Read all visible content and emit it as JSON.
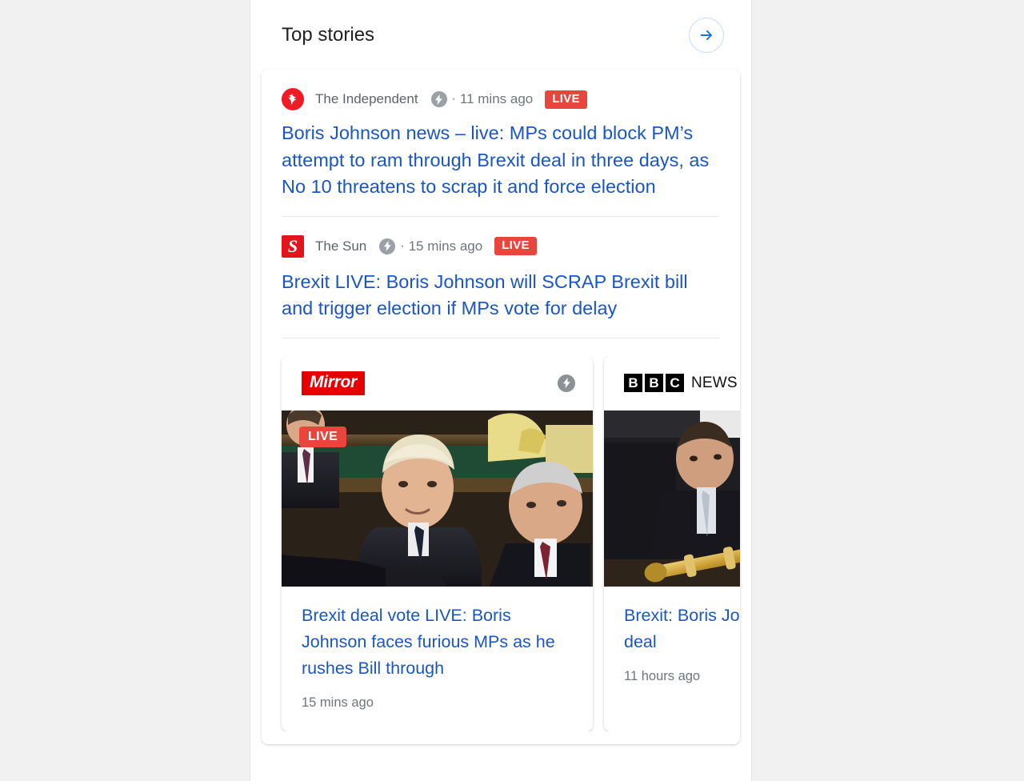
{
  "section": {
    "title": "Top stories",
    "more_button_icon": "arrow-right-icon",
    "accent_link_color": "#1a56c4",
    "live_badge_color": "#e8453c",
    "more_button_border_color": "#c6dafc"
  },
  "text_stories": [
    {
      "source": "The Independent",
      "source_logo": "the-independent-logo",
      "amp_icon": "amp-lightning-icon",
      "separator": "·",
      "timestamp": "11 mins ago",
      "live_label": "LIVE",
      "headline": "Boris Johnson news – live: MPs could block PM’s attempt to ram through Brexit deal in three days, as No 10 threatens to scrap it and force election"
    },
    {
      "source": "The Sun",
      "source_logo": "the-sun-logo",
      "source_logo_letter": "S",
      "amp_icon": "amp-lightning-icon",
      "separator": "·",
      "timestamp": "15 mins ago",
      "live_label": "LIVE",
      "headline": "Brexit LIVE: Boris Johnson will SCRAP Brexit bill and trigger election if MPs vote for delay"
    }
  ],
  "carousel_cards": [
    {
      "publisher": "Mirror",
      "publisher_logo": "mirror-logo",
      "amp_icon": "amp-lightning-icon",
      "thumbnail": "boris-johnson-commons-bench-photo",
      "live_label": "LIVE",
      "title": "Brexit deal vote LIVE: Boris Johnson faces furious MPs as he rushes Bill through",
      "timestamp": "15 mins ago"
    },
    {
      "publisher": "BBC NEWS",
      "publisher_logo": "bbc-news-logo",
      "bbc_letters": [
        "B",
        "B",
        "C"
      ],
      "bbc_word": "NEWS",
      "thumbnail": "commons-mace-photo",
      "title": "Brexit: Boris Johnson push to get deal",
      "timestamp": "11 hours ago"
    }
  ]
}
